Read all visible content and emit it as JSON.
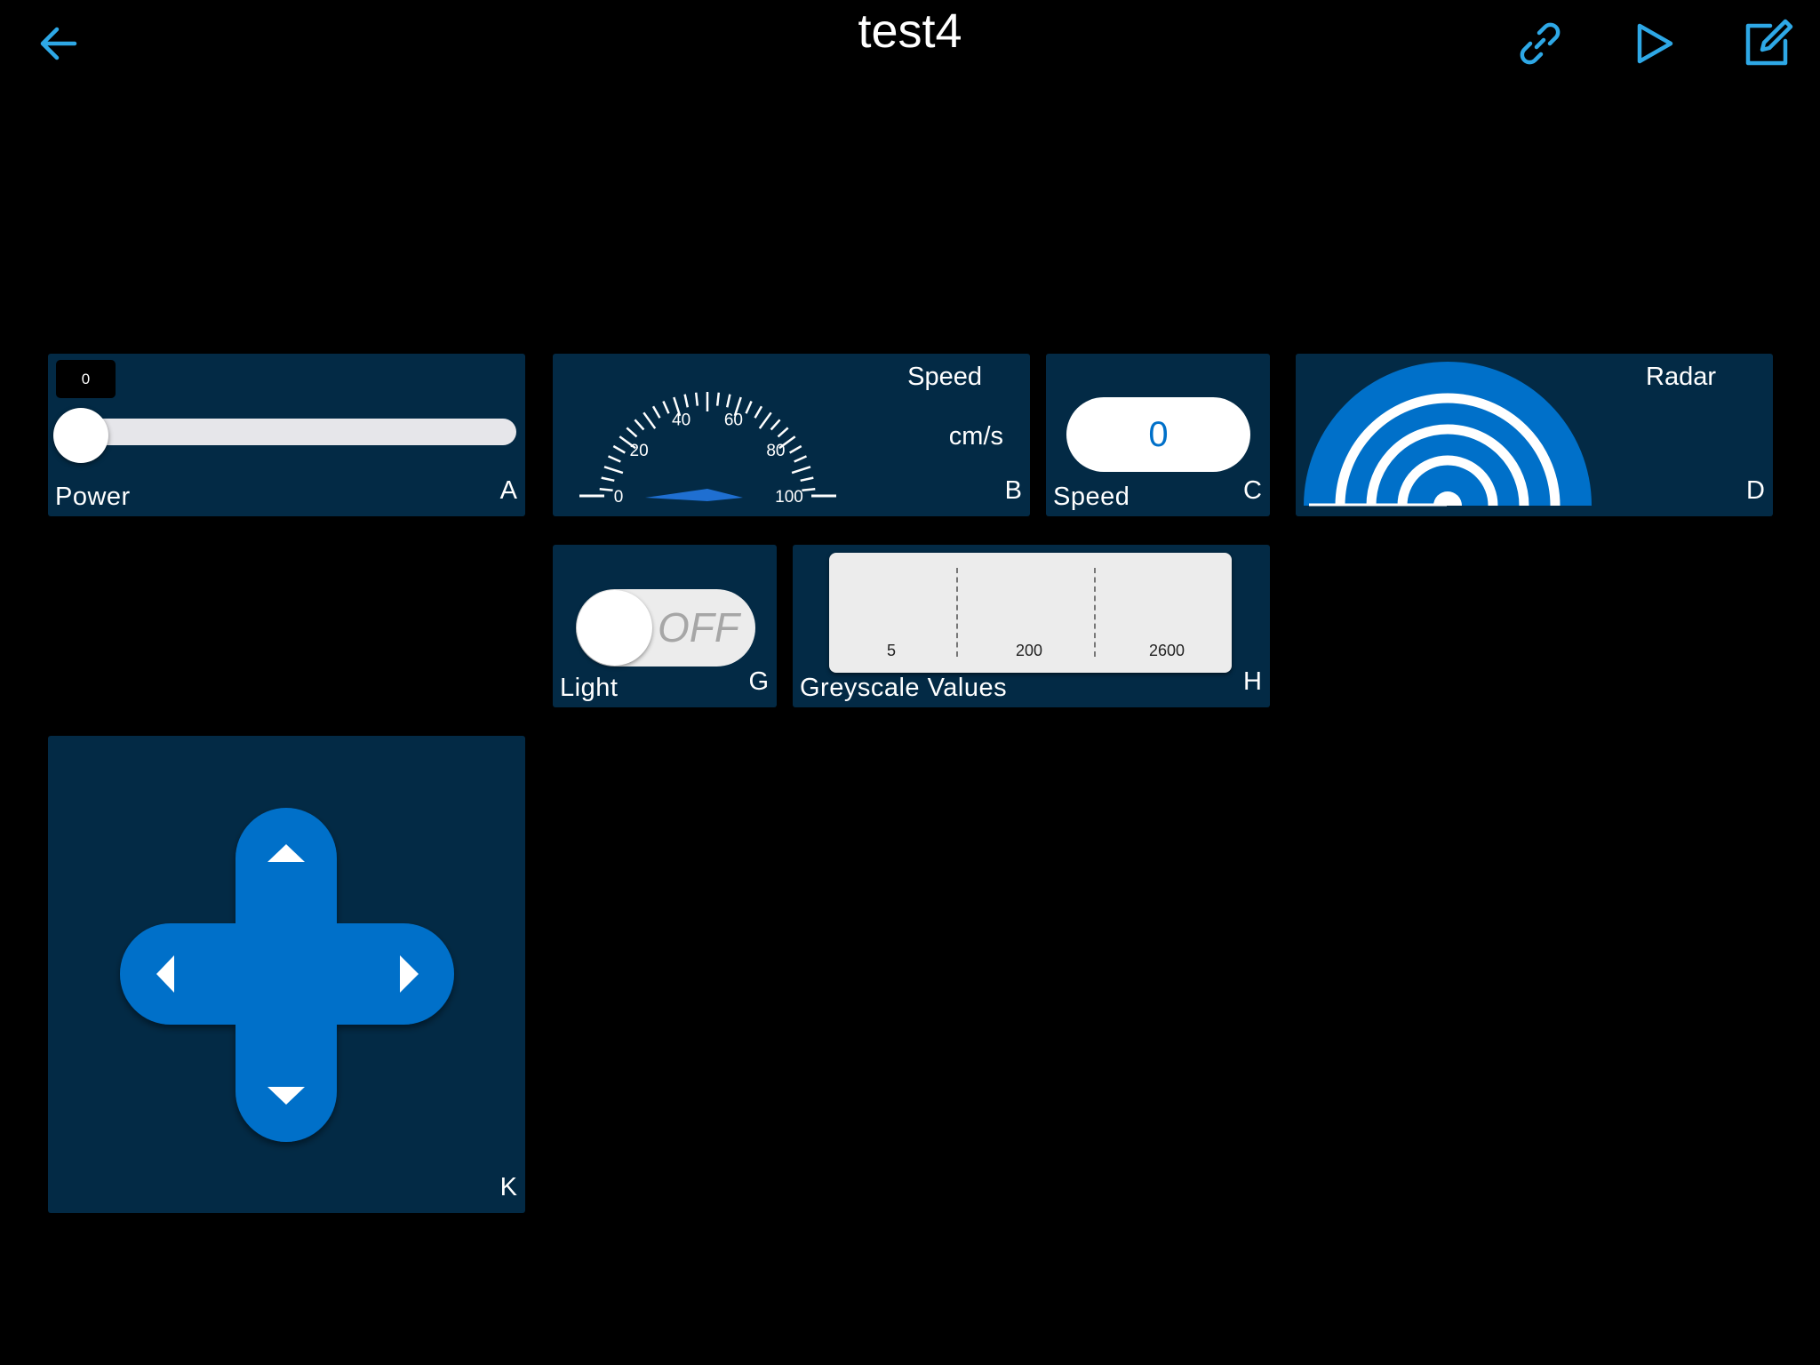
{
  "header": {
    "title": "test4",
    "back_icon": "arrow-left-icon",
    "link_icon": "link-icon",
    "play_icon": "play-icon",
    "edit_icon": "edit-icon",
    "accent_color": "#2EA8E6"
  },
  "colors": {
    "widget_bg": "#032A45",
    "blue": "#0070C9",
    "page_bg": "#000000"
  },
  "widgets": {
    "slider": {
      "value": "0",
      "label": "Power",
      "letter": "A",
      "level": 0
    },
    "gauge": {
      "name": "Speed",
      "unit": "cm/s",
      "letter": "B",
      "ticks": [
        "0",
        "20",
        "40",
        "60",
        "80",
        "100"
      ],
      "min": 0,
      "max": 100,
      "value": 0
    },
    "value_display": {
      "value": "0",
      "label": "Speed",
      "letter": "C"
    },
    "radar": {
      "name": "Radar",
      "letter": "D"
    },
    "switch": {
      "state": "OFF",
      "label": "Light",
      "letter": "G"
    },
    "greyscale": {
      "label": "Greyscale Values",
      "letter": "H",
      "ticks": [
        "5",
        "200",
        "2600"
      ]
    },
    "dpad": {
      "letter": "K",
      "up_icon": "triangle-up-icon",
      "down_icon": "triangle-down-icon",
      "left_icon": "triangle-left-icon",
      "right_icon": "triangle-right-icon"
    }
  }
}
